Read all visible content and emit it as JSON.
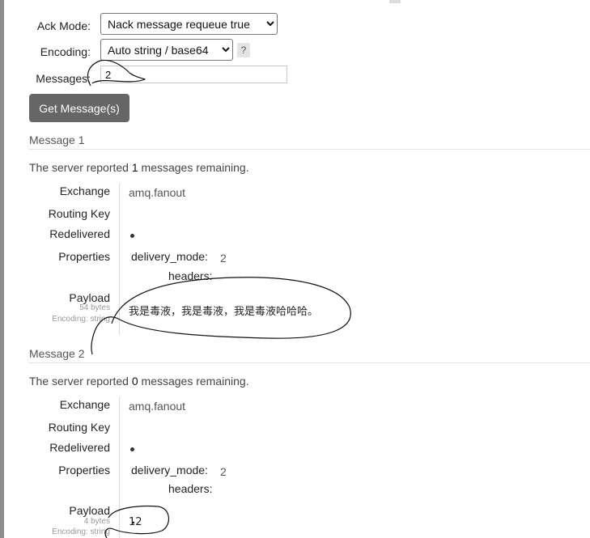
{
  "form": {
    "ack_mode_label": "Ack Mode:",
    "ack_mode_value": "Nack message requeue true",
    "encoding_label": "Encoding:",
    "encoding_value": "Auto string / base64",
    "help_label": "?",
    "messages_label": "Messages:",
    "messages_value": "2",
    "get_button_label": "Get Message(s)"
  },
  "messages": [
    {
      "title": "Message 1",
      "remaining_prefix": "The server reported ",
      "remaining_count": "1",
      "remaining_suffix": " messages remaining.",
      "exchange_label": "Exchange",
      "exchange_value": "amq.fanout",
      "routing_key_label": "Routing Key",
      "redelivered_label": "Redelivered",
      "properties_label": "Properties",
      "delivery_mode_key": "delivery_mode:",
      "delivery_mode_value": "2",
      "headers_key": "headers:",
      "payload_label": "Payload",
      "payload_bytes": "54 bytes",
      "payload_encoding": "Encoding: string",
      "payload_value": "我是毒液，我是毒液，我是毒液哈哈哈。"
    },
    {
      "title": "Message 2",
      "remaining_prefix": "The server reported ",
      "remaining_count": "0",
      "remaining_suffix": " messages remaining.",
      "exchange_label": "Exchange",
      "exchange_value": "amq.fanout",
      "routing_key_label": "Routing Key",
      "redelivered_label": "Redelivered",
      "properties_label": "Properties",
      "delivery_mode_key": "delivery_mode:",
      "delivery_mode_value": "2",
      "headers_key": "headers:",
      "payload_label": "Payload",
      "payload_bytes": "4 bytes",
      "payload_encoding": "Encoding: string",
      "payload_value": "12"
    }
  ]
}
